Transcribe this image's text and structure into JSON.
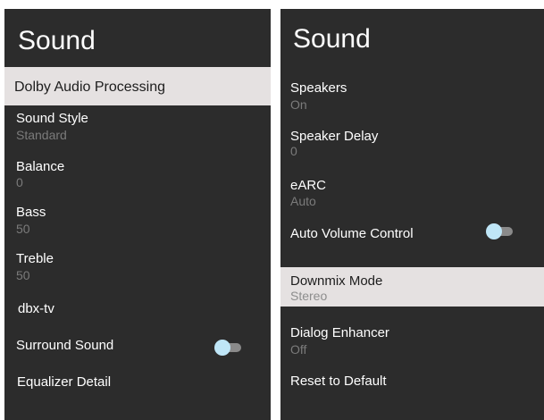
{
  "left_panel": {
    "title": "Sound",
    "items": [
      {
        "label": "Dolby Audio Processing"
      },
      {
        "label": "Sound Style",
        "value": "Standard"
      },
      {
        "label": "Balance",
        "value": "0"
      },
      {
        "label": "Bass",
        "value": "50"
      },
      {
        "label": "Treble",
        "value": "50"
      },
      {
        "label": "dbx-tv"
      },
      {
        "label": "Surround Sound",
        "toggle": "off"
      },
      {
        "label": "Equalizer Detail"
      }
    ]
  },
  "right_panel": {
    "title": "Sound",
    "items": [
      {
        "label": "Speakers",
        "value": "On"
      },
      {
        "label": "Speaker Delay",
        "value": "0"
      },
      {
        "label": "eARC",
        "value": "Auto"
      },
      {
        "label": "Auto Volume Control",
        "toggle": "off"
      },
      {
        "label": "Downmix Mode",
        "value": "Stereo"
      },
      {
        "label": "Dialog Enhancer",
        "value": "Off"
      },
      {
        "label": "Reset to Default"
      }
    ]
  },
  "colors": {
    "panel_bg": "#2c2c2c",
    "highlight_bg": "#e5e1e1",
    "toggle_knob": "#bfe6f7"
  }
}
